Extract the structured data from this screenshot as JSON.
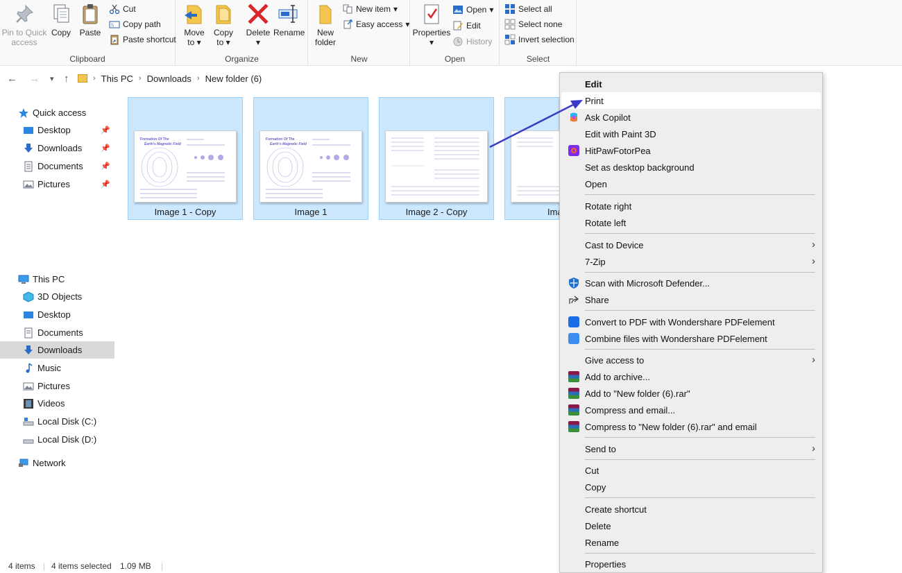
{
  "ribbon": {
    "clipboard": {
      "label": "Clipboard",
      "pin_line1": "Pin to Quick",
      "pin_line2": "access",
      "copy": "Copy",
      "paste": "Paste",
      "cut": "Cut",
      "copy_path": "Copy path",
      "paste_shortcut": "Paste shortcut"
    },
    "organize": {
      "label": "Organize",
      "move_line1": "Move",
      "move_line2": "to",
      "copy_line1": "Copy",
      "copy_line2": "to",
      "delete": "Delete",
      "rename": "Rename"
    },
    "new": {
      "label": "New",
      "new_folder_line1": "New",
      "new_folder_line2": "folder",
      "new_item": "New item",
      "easy_access": "Easy access"
    },
    "open": {
      "label": "Open",
      "properties": "Properties",
      "open": "Open",
      "edit": "Edit",
      "history": "History"
    },
    "select": {
      "label": "Select",
      "select_all": "Select all",
      "select_none": "Select none",
      "invert_selection": "Invert selection"
    }
  },
  "address": {
    "crumbs": [
      "This PC",
      "Downloads",
      "New folder (6)"
    ]
  },
  "nav": {
    "quick_access": "Quick access",
    "quick_items": [
      "Desktop",
      "Downloads",
      "Documents",
      "Pictures"
    ],
    "this_pc": "This PC",
    "pc_items": [
      "3D Objects",
      "Desktop",
      "Documents",
      "Downloads",
      "Music",
      "Pictures",
      "Videos",
      "Local Disk (C:)",
      "Local Disk (D:)"
    ],
    "network": "Network"
  },
  "files": [
    {
      "name": "Image 1 - Copy"
    },
    {
      "name": "Image 1"
    },
    {
      "name": "Image 2 - Copy"
    },
    {
      "name": "Ima"
    }
  ],
  "thumb_text": {
    "title_line1": "Formation Of The",
    "title_line2": "Earth's Magnetic Field"
  },
  "status": {
    "items": "4 items",
    "selected": "4 items selected",
    "size": "1.09 MB"
  },
  "context_menu": {
    "edit": "Edit",
    "print": "Print",
    "ask_copilot": "Ask Copilot",
    "edit_paint3d": "Edit with Paint 3D",
    "hitpaw": "HitPawFotorPea",
    "set_desktop_bg": "Set as desktop background",
    "open": "Open",
    "rotate_right": "Rotate right",
    "rotate_left": "Rotate left",
    "cast": "Cast to Device",
    "zip7": "7-Zip",
    "scan_defender": "Scan with Microsoft Defender...",
    "share": "Share",
    "convert_pdf": "Convert to PDF with Wondershare PDFelement",
    "combine_files": "Combine files with Wondershare PDFelement",
    "give_access": "Give access to",
    "add_archive": "Add to archive...",
    "add_rar": "Add to \"New folder (6).rar\"",
    "compress_email": "Compress and email...",
    "compress_rar_email": "Compress to \"New folder (6).rar\" and email",
    "send_to": "Send to",
    "cut": "Cut",
    "copy": "Copy",
    "create_shortcut": "Create shortcut",
    "delete": "Delete",
    "rename": "Rename",
    "properties": "Properties"
  },
  "colors": {
    "selection_bg": "#cce8ff",
    "selection_border": "#99d1ff",
    "annotation_arrow": "#3a3ac8",
    "delete_red": "#d9262c",
    "folder_yellow": "#f3c74e"
  }
}
